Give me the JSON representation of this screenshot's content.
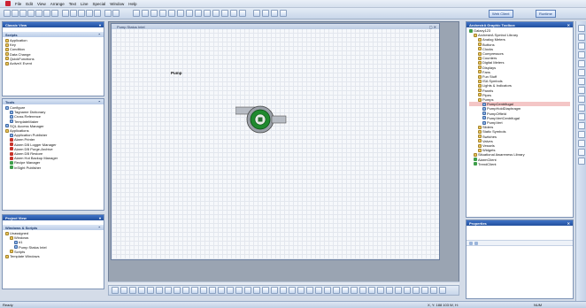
{
  "menubar": {
    "items": [
      "File",
      "Edit",
      "View",
      "Arrange",
      "Text",
      "Line",
      "Special",
      "Window",
      "Help"
    ]
  },
  "toolbar": {
    "right_buttons": [
      "Web Client",
      "Runtime"
    ]
  },
  "left": {
    "classic_view_title": "Classic View",
    "scripts_title": "Scripts",
    "scripts_items": [
      "Application",
      "Key",
      "Condition",
      "Data Change",
      "QuickFunctions",
      "ActiveX Event"
    ],
    "tools_title": "Tools",
    "tools_items": [
      {
        "label": "Configure",
        "indent": 0,
        "icon": "wrench-icon"
      },
      {
        "label": "Tagname Dictionary",
        "indent": 1,
        "icon": "dictionary-icon"
      },
      {
        "label": "Cross Reference",
        "indent": 1,
        "icon": "cross-reference-icon"
      },
      {
        "label": "TemplateMaker",
        "indent": 1,
        "icon": "template-icon"
      },
      {
        "label": "SQL Access Manager",
        "indent": 0,
        "icon": "database-icon"
      },
      {
        "label": "Applications",
        "indent": 0,
        "icon": "folder-icon"
      },
      {
        "label": "Application Publisher",
        "indent": 1,
        "icon": "publisher-icon"
      },
      {
        "label": "Alarm Printer",
        "indent": 1,
        "icon": "alarm-icon"
      },
      {
        "label": "Alarm DB Logger Manager",
        "indent": 1,
        "icon": "alarm-icon"
      },
      {
        "label": "Alarm DB Purge-Archive",
        "indent": 1,
        "icon": "alarm-icon"
      },
      {
        "label": "Alarm DB Restore",
        "indent": 1,
        "icon": "alarm-icon"
      },
      {
        "label": "Alarm Hot Backup Manager",
        "indent": 1,
        "icon": "alarm-icon"
      },
      {
        "label": "Recipe Manager",
        "indent": 1,
        "icon": "recipe-icon"
      },
      {
        "label": "InSight Publisher",
        "indent": 1,
        "icon": "insight-icon"
      }
    ],
    "project_view_title": "Project View",
    "windows_scripts_title": "Windows & Scripts",
    "project_items": [
      {
        "label": "Unassigned",
        "indent": 0,
        "icon": "folder-icon"
      },
      {
        "label": "Windows",
        "indent": 1,
        "icon": "folder-icon"
      },
      {
        "label": "#1",
        "indent": 2,
        "icon": "window-icon"
      },
      {
        "label": "Pump Status Intel",
        "indent": 2,
        "icon": "window-icon"
      },
      {
        "label": "Scripts",
        "indent": 1,
        "icon": "folder-icon"
      },
      {
        "label": "Template Windows",
        "indent": 0,
        "icon": "folder-icon"
      }
    ]
  },
  "canvas": {
    "window_title": "Pump Status Intel",
    "pump_label": "Pump"
  },
  "right": {
    "toolbox_title": "ArchestrA Graphic Toolbox",
    "tree_items": [
      {
        "label": "Galaxy123",
        "indent": 0,
        "icon": "galaxy-icon"
      },
      {
        "label": "ArchestrA Symbol Library",
        "indent": 1,
        "icon": "folder-icon"
      },
      {
        "label": "Analog Meters",
        "indent": 2,
        "icon": "folder-icon"
      },
      {
        "label": "Buttons",
        "indent": 2,
        "icon": "folder-icon"
      },
      {
        "label": "Clocks",
        "indent": 2,
        "icon": "folder-icon"
      },
      {
        "label": "Compressors",
        "indent": 2,
        "icon": "folder-icon"
      },
      {
        "label": "Counters",
        "indent": 2,
        "icon": "folder-icon"
      },
      {
        "label": "Digital Meters",
        "indent": 2,
        "icon": "folder-icon"
      },
      {
        "label": "Displays",
        "indent": 2,
        "icon": "folder-icon"
      },
      {
        "label": "Fans",
        "indent": 2,
        "icon": "folder-icon"
      },
      {
        "label": "Fun Stuff",
        "indent": 2,
        "icon": "folder-icon"
      },
      {
        "label": "ISA Symbols",
        "indent": 2,
        "icon": "folder-icon"
      },
      {
        "label": "Lights & Indicators",
        "indent": 2,
        "icon": "folder-icon"
      },
      {
        "label": "Panels",
        "indent": 2,
        "icon": "folder-icon"
      },
      {
        "label": "Pipes",
        "indent": 2,
        "icon": "folder-icon"
      },
      {
        "label": "Pumps",
        "indent": 2,
        "icon": "folder-icon"
      },
      {
        "label": "PumpCentrifugal",
        "indent": 3,
        "icon": "symbol-icon",
        "selected": true
      },
      {
        "label": "PumpHoldDiaphragm",
        "indent": 3,
        "icon": "symbol-icon"
      },
      {
        "label": "PumpOffield",
        "indent": 3,
        "icon": "symbol-icon"
      },
      {
        "label": "PumpVertCentrifugal",
        "indent": 3,
        "icon": "symbol-icon"
      },
      {
        "label": "PumpVert",
        "indent": 3,
        "icon": "symbol-icon"
      },
      {
        "label": "Sliders",
        "indent": 2,
        "icon": "folder-icon"
      },
      {
        "label": "Static Symbols",
        "indent": 2,
        "icon": "folder-icon"
      },
      {
        "label": "Switches",
        "indent": 2,
        "icon": "folder-icon"
      },
      {
        "label": "Valves",
        "indent": 2,
        "icon": "folder-icon"
      },
      {
        "label": "Vessels",
        "indent": 2,
        "icon": "folder-icon"
      },
      {
        "label": "Widgets",
        "indent": 2,
        "icon": "folder-icon"
      },
      {
        "label": "Situational Awareness Library",
        "indent": 1,
        "icon": "folder-icon"
      },
      {
        "label": "AlarmClient",
        "indent": 1,
        "icon": "client-icon"
      },
      {
        "label": "TrendClient",
        "indent": 1,
        "icon": "client-icon"
      }
    ],
    "properties_title": "Properties"
  },
  "status": {
    "left": "Ready",
    "coords": "X, Y: 188  103  W, H:",
    "right": "NUM"
  },
  "colors": {
    "header_blue": "#2a5aa8",
    "pump_green": "#1f8a2e",
    "selected_row": "#f4c6c6"
  }
}
